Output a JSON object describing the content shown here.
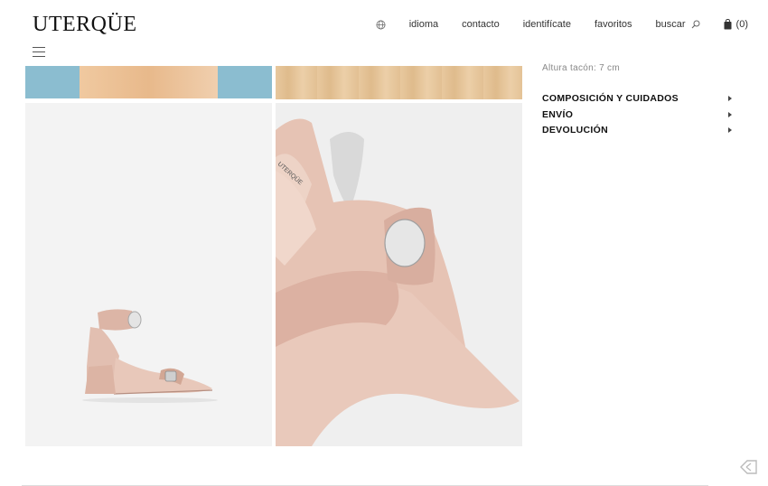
{
  "header": {
    "logo": "UTERQÜE",
    "nav": {
      "language": "idioma",
      "contact": "contacto",
      "login": "identifícate",
      "favorites": "favoritos",
      "search": "buscar",
      "cart_count": "(0)"
    }
  },
  "product": {
    "heel_height": "Altura tacón: 7 cm",
    "sections": [
      {
        "label": "COMPOSICIÓN Y CUIDADOS"
      },
      {
        "label": "ENVÍO"
      },
      {
        "label": "DEVOLUCIÓN"
      }
    ],
    "shoe_color": "#e7c6b8",
    "brand_stamp": "UTERQÜE"
  }
}
